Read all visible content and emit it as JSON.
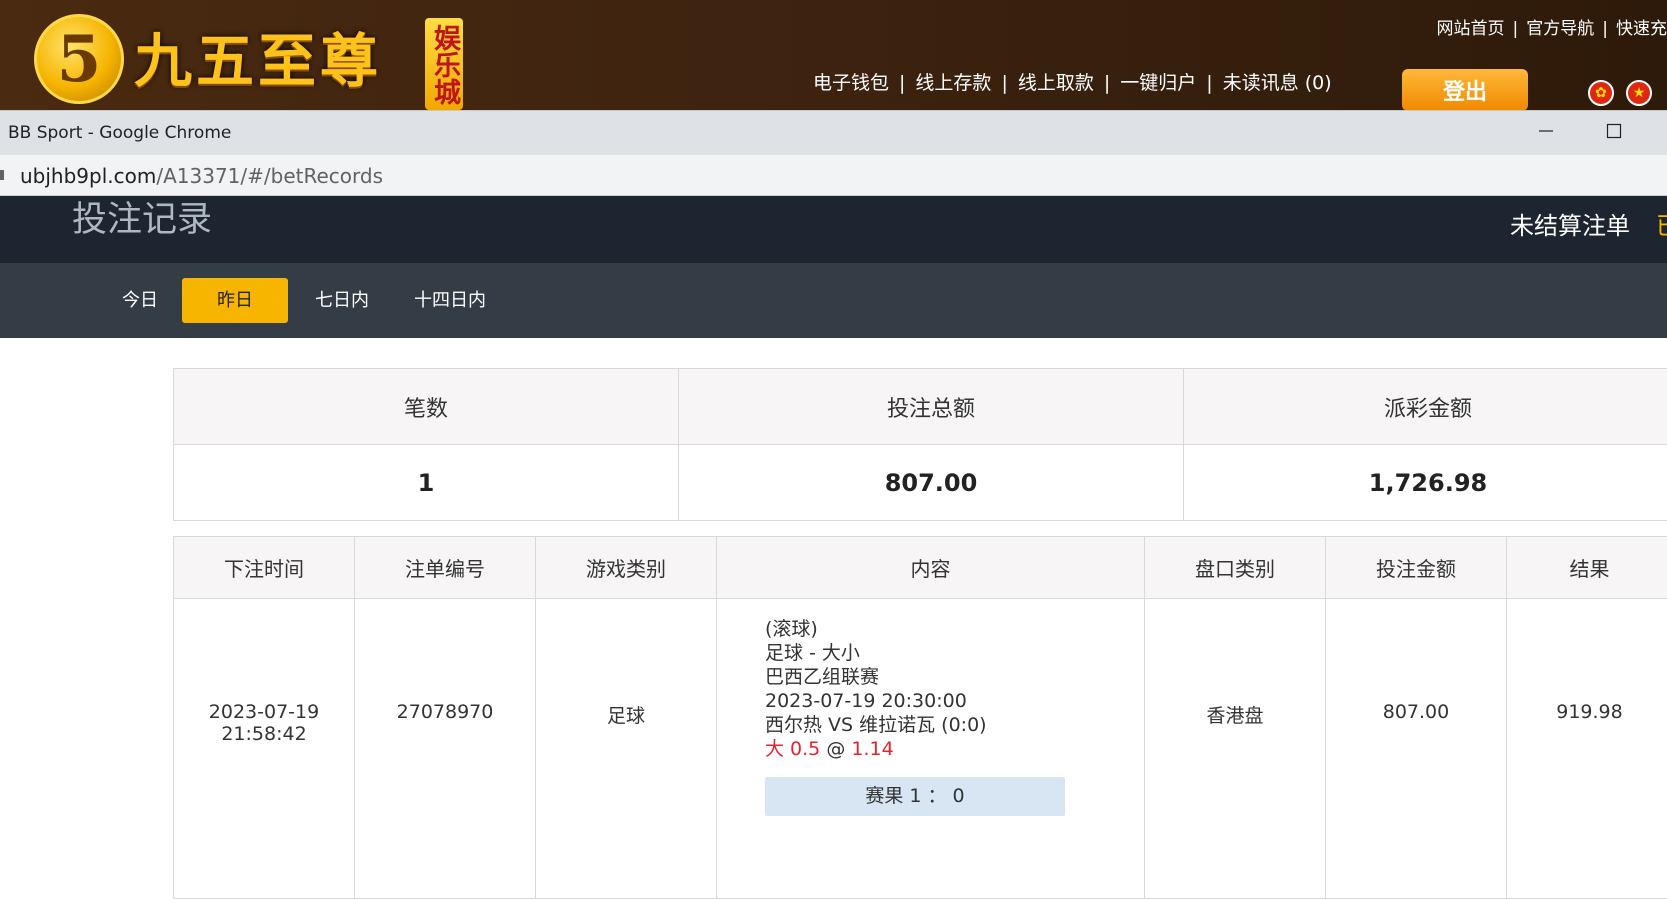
{
  "site": {
    "logo_text": "九五至尊",
    "logo_numeral": "5",
    "logo_badge": "娱乐城",
    "top_links": [
      "网站首页",
      "官方导航",
      "快速充"
    ],
    "nav_links": [
      "电子钱包",
      "线上存款",
      "线上取款",
      "一键归户",
      "未读讯息 (0)"
    ],
    "logout_label": "登出"
  },
  "window": {
    "title": "BB Sport - Google Chrome",
    "url_host": "ubjhb9pl.com",
    "url_path": "/A13371/#/betRecords"
  },
  "page": {
    "title": "投注记录",
    "unsettled_label": "未结算注单",
    "settled_label": "已"
  },
  "filters": {
    "items": [
      "今日",
      "昨日",
      "七日内",
      "十四日内"
    ],
    "active": "昨日"
  },
  "summary": {
    "headers": [
      "笔数",
      "投注总额",
      "派彩金额"
    ],
    "values": [
      "1",
      "807.00",
      "1,726.98"
    ]
  },
  "records": {
    "headers": [
      "下注时间",
      "注单编号",
      "游戏类别",
      "内容",
      "盘口类别",
      "投注金额",
      "结果"
    ],
    "rows": [
      {
        "time_date": "2023-07-19",
        "time_clock": "21:58:42",
        "id": "27078970",
        "game": "足球",
        "content": {
          "line1": "(滚球)",
          "line2": "足球 - 大小",
          "line3": "巴西乙组联赛",
          "line4": "2023-07-19 20:30:00",
          "line5": "西尔热 VS 维拉诺瓦 (0:0)",
          "bet_pick": "大 0.5",
          "bet_at": "@",
          "bet_odds": "1.14",
          "score": "赛果 1 ： 0"
        },
        "odds_type": "香港盘",
        "amount": "807.00",
        "result": "919.98"
      }
    ]
  },
  "colors": {
    "accent": "#f7b500",
    "page_header_bg": "#1c2530",
    "filter_bar_bg": "#343c46",
    "highlight_red": "#e8232f",
    "result_box_bg": "#d7e6f2"
  }
}
